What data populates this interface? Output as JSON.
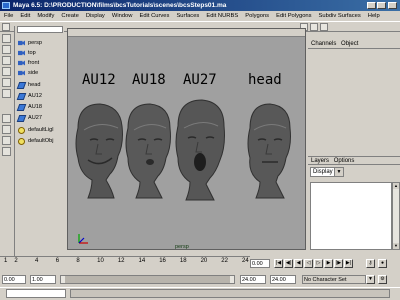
{
  "window": {
    "title": "Maya 6.5: D:\\PRODUCTION\\films\\bcsTutorials\\scenes\\bcsSteps01.ma"
  },
  "menu": [
    "File",
    "Edit",
    "Modify",
    "Create",
    "Display",
    "Window",
    "Edit Curves",
    "Surfaces",
    "Edit NURBS",
    "Polygons",
    "Edit Polygons",
    "Subdiv Surfaces",
    "Help"
  ],
  "outliner": {
    "items": [
      {
        "label": "persp",
        "icon": "camera-icon"
      },
      {
        "label": "top",
        "icon": "camera-icon"
      },
      {
        "label": "front",
        "icon": "camera-icon"
      },
      {
        "label": "side",
        "icon": "camera-icon"
      },
      {
        "label": "head",
        "icon": "mesh-icon"
      },
      {
        "label": "AU12",
        "icon": "mesh-icon"
      },
      {
        "label": "AU18",
        "icon": "mesh-icon"
      },
      {
        "label": "AU27",
        "icon": "mesh-icon"
      },
      {
        "label": "defaultLigl",
        "icon": "light-icon"
      },
      {
        "label": "defaultObj",
        "icon": "light-icon"
      }
    ]
  },
  "viewport": {
    "labels": [
      "AU12",
      "AU18",
      "AU27",
      "head"
    ],
    "camera": "persp"
  },
  "channel_box": {
    "tabs": [
      "Channels",
      "Object"
    ]
  },
  "layers": {
    "tabs": [
      "Layers",
      "Options"
    ],
    "display_value": "Display"
  },
  "timeline": {
    "ticks": [
      "1",
      "2",
      "4",
      "6",
      "8",
      "10",
      "12",
      "14",
      "16",
      "18",
      "20",
      "22",
      "24"
    ],
    "current_time": "0.00"
  },
  "range": {
    "start": "0.00",
    "min": "1.00",
    "max": "24.00",
    "end": "24.00",
    "character_set": "No Character Set"
  }
}
